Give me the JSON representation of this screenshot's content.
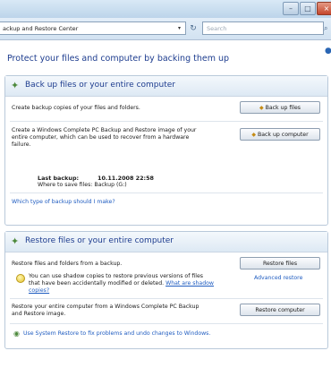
{
  "window": {
    "address": "ackup and Restore Center",
    "search_placeholder": "Search",
    "icons": {
      "minimize": "–",
      "maximize": "□",
      "close": "×",
      "refresh": "↻",
      "search": "⌕",
      "help": "●",
      "dropdown": "▾"
    }
  },
  "page": {
    "title": "Protect your files and computer by backing them up"
  },
  "backup": {
    "header": "Back up files or your entire computer",
    "files_desc": "Create backup copies of your files and folders.",
    "files_button": "Back up files",
    "computer_desc_lines": [
      "Create a Windows Complete PC Backup and Restore image of your",
      "entire computer, which can be used to recover from a hardware",
      "failure."
    ],
    "computer_button": "Back up computer",
    "last_backup_label": "Last backup:",
    "last_backup_value": "10.11.2008 22:58",
    "save_location": "Where to save files: Backup (G:)",
    "help_link": "Which type of backup should I make?"
  },
  "restore": {
    "header": "Restore files or your entire computer",
    "files_desc": "Restore files and folders from a backup.",
    "files_button": "Restore files",
    "advanced_link": "Advanced restore",
    "shadow_line1": "You can use shadow copies to restore previous versions of files",
    "shadow_line2_prefix": "that have been accidentally modified or deleted.",
    "shadow_link_part1": "What are shadow",
    "shadow_link_part2": "copies?",
    "computer_desc_lines": [
      "Restore your entire computer from a Windows Complete PC Backup",
      "and Restore image."
    ],
    "computer_button": "Restore computer",
    "system_restore_link": "Use System Restore to fix problems and undo changes to Windows."
  }
}
